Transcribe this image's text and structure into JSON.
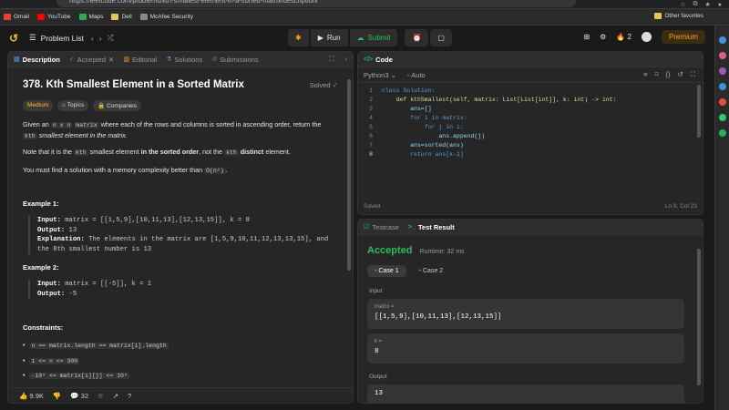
{
  "browser": {
    "url": "https://leetcode.com/problems/kth-smallest-element-in-a-sorted-matrix/description/",
    "bookmarks": [
      "Gmail",
      "YouTube",
      "Maps",
      "Dell",
      "McAfee Security"
    ],
    "other_favorites": "Other favorites"
  },
  "nav": {
    "problem_list": "Problem List",
    "run": "Run",
    "submit": "Submit",
    "streak": "2",
    "premium": "Premium"
  },
  "left_tabs": [
    "Description",
    "Accepted",
    "Editorial",
    "Solutions",
    "Submissions"
  ],
  "problem": {
    "title": "378. Kth Smallest Element in a Sorted Matrix",
    "solved": "Solved",
    "difficulty": "Medium",
    "topics": "Topics",
    "companies": "Companies",
    "p1_a": "Given an",
    "p1_code1": "n x n",
    "p1_b": "matrix",
    "p1_code2": "matrix",
    "p1_c": "where each of the rows and columns is sorted in ascending order, return the",
    "p1_code3": "kth",
    "p1_d": "smallest element in the matrix.",
    "p2_a": "Note that it is the",
    "p2_code1": "kth",
    "p2_b": "smallest element",
    "p2_bold1": "in the sorted order",
    "p2_c": ", not the",
    "p2_code2": "kth",
    "p2_bold2": "distinct",
    "p2_d": "element.",
    "p3_a": "You must find a solution with a memory complexity better than",
    "p3_code": "O(n²)",
    "p3_b": "."
  },
  "examples": [
    {
      "heading": "Example 1:",
      "input_label": "Input:",
      "input": "matrix = [[1,5,9],[10,11,13],[12,13,15]], k = 8",
      "output_label": "Output:",
      "output": "13",
      "explanation_label": "Explanation:",
      "explanation": "The elements in the matrix are [1,5,9,10,11,12,13,13,15], and the 8th smallest number is 13"
    },
    {
      "heading": "Example 2:",
      "input_label": "Input:",
      "input": "matrix = [[-5]], k = 1",
      "output_label": "Output:",
      "output": "-5"
    }
  ],
  "constraints": {
    "heading": "Constraints:",
    "items": [
      "n == matrix.length == matrix[i].length",
      "1 <= n <= 300",
      "-10⁹ <= matrix[i][j] <= 10⁹"
    ]
  },
  "footer": {
    "likes": "9.9K",
    "comments": "32"
  },
  "code_panel": {
    "tab": "Code",
    "language": "Python3",
    "auto": "Auto",
    "saved": "Saved",
    "cursor": "Ln 8, Col 23",
    "lines": [
      {
        "n": "1",
        "t": "class Solution:"
      },
      {
        "n": "2",
        "t": "    def kthSmallest(self, matrix: List[List[int]], k: int) -> int:"
      },
      {
        "n": "3",
        "t": "        ans=[]"
      },
      {
        "n": "4",
        "t": "        for i in matrix:"
      },
      {
        "n": "5",
        "t": "            for j in i:"
      },
      {
        "n": "6",
        "t": "                ans.append(j)"
      },
      {
        "n": "7",
        "t": "        ans=sorted(ans)"
      },
      {
        "n": "8",
        "t": "        return ans[k-1]"
      }
    ]
  },
  "result_panel": {
    "tabs": [
      "Testcase",
      "Test Result"
    ],
    "status": "Accepted",
    "runtime": "Runtime: 32 ms",
    "cases": [
      "Case 1",
      "Case 2"
    ],
    "input_label": "Input",
    "matrix_label": "matrix =",
    "matrix_value": "[[1,5,9],[10,11,13],[12,13,15]]",
    "k_label": "k =",
    "k_value": "8",
    "output_label": "Output",
    "output_value": "13"
  }
}
